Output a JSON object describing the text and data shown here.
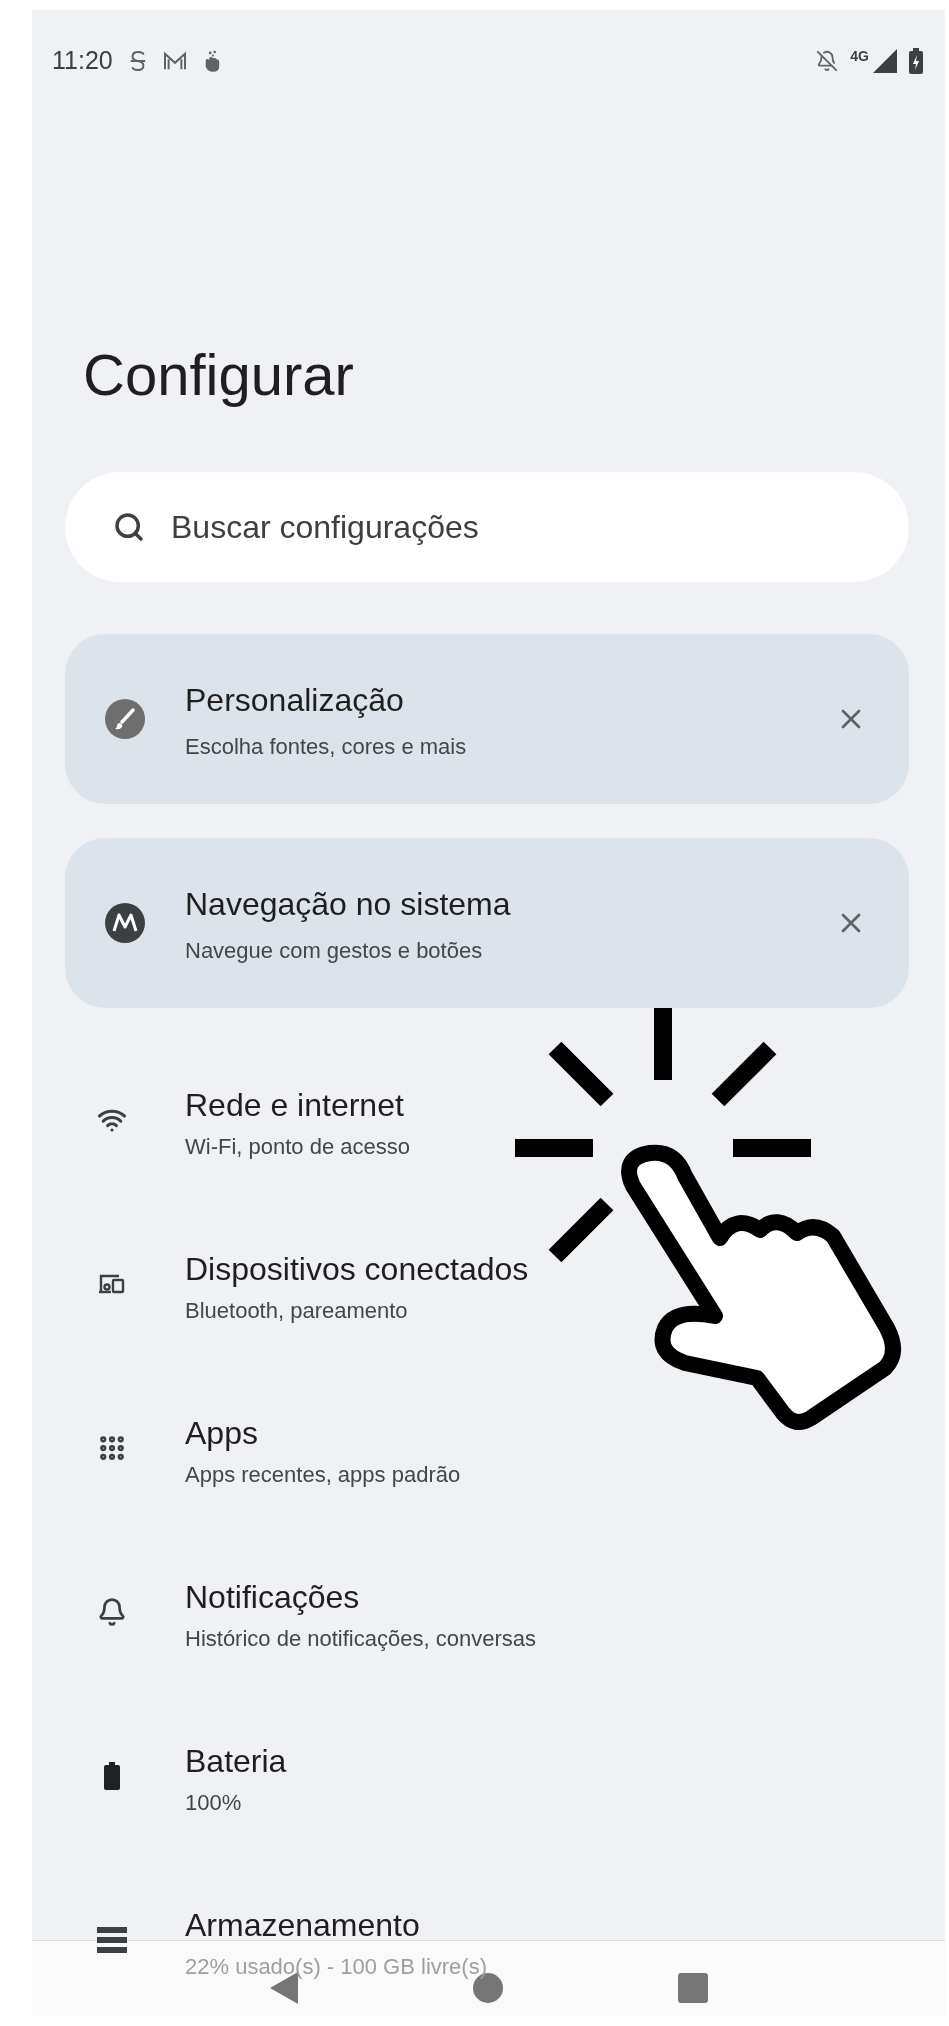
{
  "status_bar": {
    "time": "11:20",
    "network": "4G"
  },
  "title": "Configurar",
  "search": {
    "placeholder": "Buscar configurações"
  },
  "suggestions": [
    {
      "kind": "brush",
      "title": "Personalização",
      "subtitle": "Escolha fontes, cores e mais"
    },
    {
      "kind": "logo",
      "title": "Navegação no sistema",
      "subtitle": "Navegue com gestos e botões"
    }
  ],
  "items": [
    {
      "kind": "wifi",
      "title": "Rede e internet",
      "subtitle": "Wi-Fi, ponto de acesso"
    },
    {
      "kind": "devices",
      "title": "Dispositivos conectados",
      "subtitle": "Bluetooth, pareamento"
    },
    {
      "kind": "apps",
      "title": "Apps",
      "subtitle": "Apps recentes, apps padrão"
    },
    {
      "kind": "bell",
      "title": "Notificações",
      "subtitle": "Histórico de notificações, conversas"
    },
    {
      "kind": "battery",
      "title": "Bateria",
      "subtitle": "100%"
    },
    {
      "kind": "storage",
      "title": "Armazenamento",
      "subtitle": "22% usado(s) - 100 GB livre(s)"
    }
  ]
}
